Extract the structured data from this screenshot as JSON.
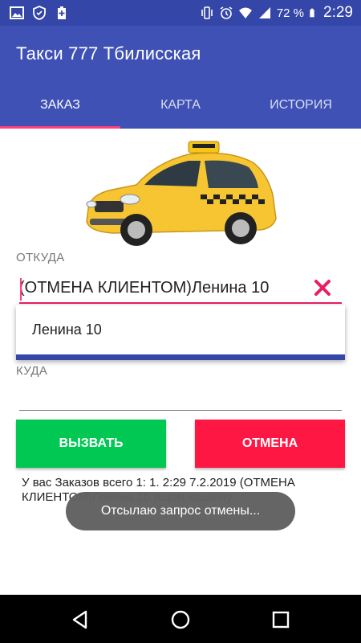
{
  "status_bar": {
    "left_icons": [
      "image-icon",
      "shield-icon",
      "battery-plus-icon"
    ],
    "right_icons": [
      "vibrate-icon",
      "alarm-icon",
      "wifi-icon",
      "signal-icon",
      "battery-icon"
    ],
    "battery": "72 %",
    "time": "2:29"
  },
  "app": {
    "title": "Такси 777 Тбилисская",
    "tabs": [
      {
        "label": "ЗАКАЗ",
        "active": true
      },
      {
        "label": "КАРТА",
        "active": false
      },
      {
        "label": "ИСТОРИЯ",
        "active": false
      }
    ]
  },
  "form": {
    "from_label": "ОТКУДА",
    "from_value": "(ОТМЕНА КЛИЕНТОМ)Ленина 10",
    "to_label": "КУДА",
    "to_value": "",
    "suggestion": "Ленина 10"
  },
  "buttons": {
    "call": "ВЫЗВАТЬ",
    "cancel": "ОТМЕНА"
  },
  "orders_info": "У вас Заказов всего 1:  1. 2:29 7.2.2019 (ОТМЕНА КЛИЕНТОМ)Ленина 10  ищем машину",
  "toast": "Отсылаю запрос отмены...",
  "colors": {
    "primary": "#3f51b5",
    "primary_dark": "#3446a8",
    "accent": "#ff4081",
    "call_button": "#00c853",
    "cancel_button": "#ff1744",
    "clear_icon": "#e91e63"
  }
}
